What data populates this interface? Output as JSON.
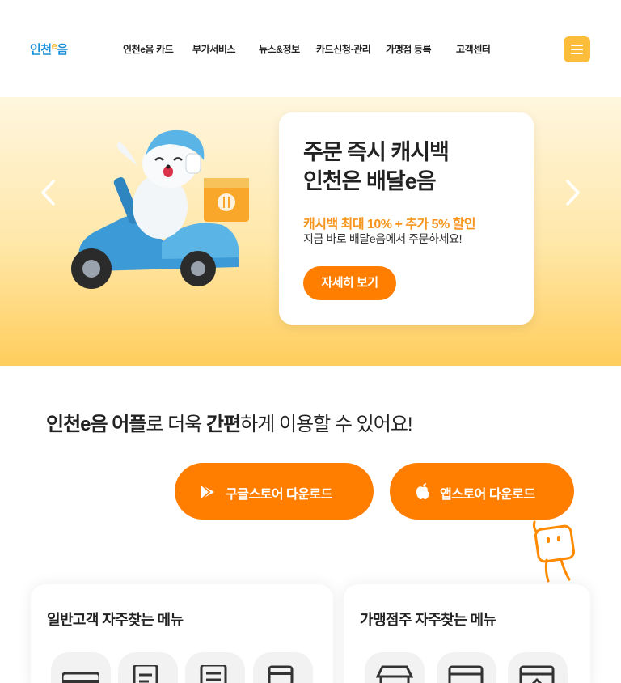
{
  "header": {
    "logo_text": "인천",
    "logo_e": "e",
    "logo_tail": "음",
    "nav": [
      "인천e음 카드",
      "부가서비스",
      "뉴스&정보",
      "카드신청·관리",
      "가맹점 등록",
      "고객센터"
    ],
    "menu_icon": "hamburger-icon"
  },
  "hero": {
    "title_line1": "주문 즉시 캐시백",
    "title_line2": "인천은 배달e음",
    "subtitle": "캐시백 최대 10% + 추가 5% 할인",
    "description": "지금 바로 배달e음에서 주문하세요!",
    "button_label": "자세히 보기",
    "illustration": "seal-mascot-riding-scooter"
  },
  "app": {
    "headline_b1": "인천e음 어플",
    "headline_t1": "로 더욱 ",
    "headline_b2": "간편",
    "headline_t2": "하게 이용할 수 있어요!",
    "google_label": "구글스토어 다운로드",
    "apple_label": "앱스토어 다운로드"
  },
  "favorites": {
    "customer_title": "일반고객 자주찾는 메뉴",
    "merchant_title": "가맹점주 자주찾는 메뉴"
  },
  "colors": {
    "accent": "#ff7e00",
    "menu_button": "#fbbd3a",
    "subtitle": "#f7941d",
    "logo_blue": "#1a8fd8"
  }
}
